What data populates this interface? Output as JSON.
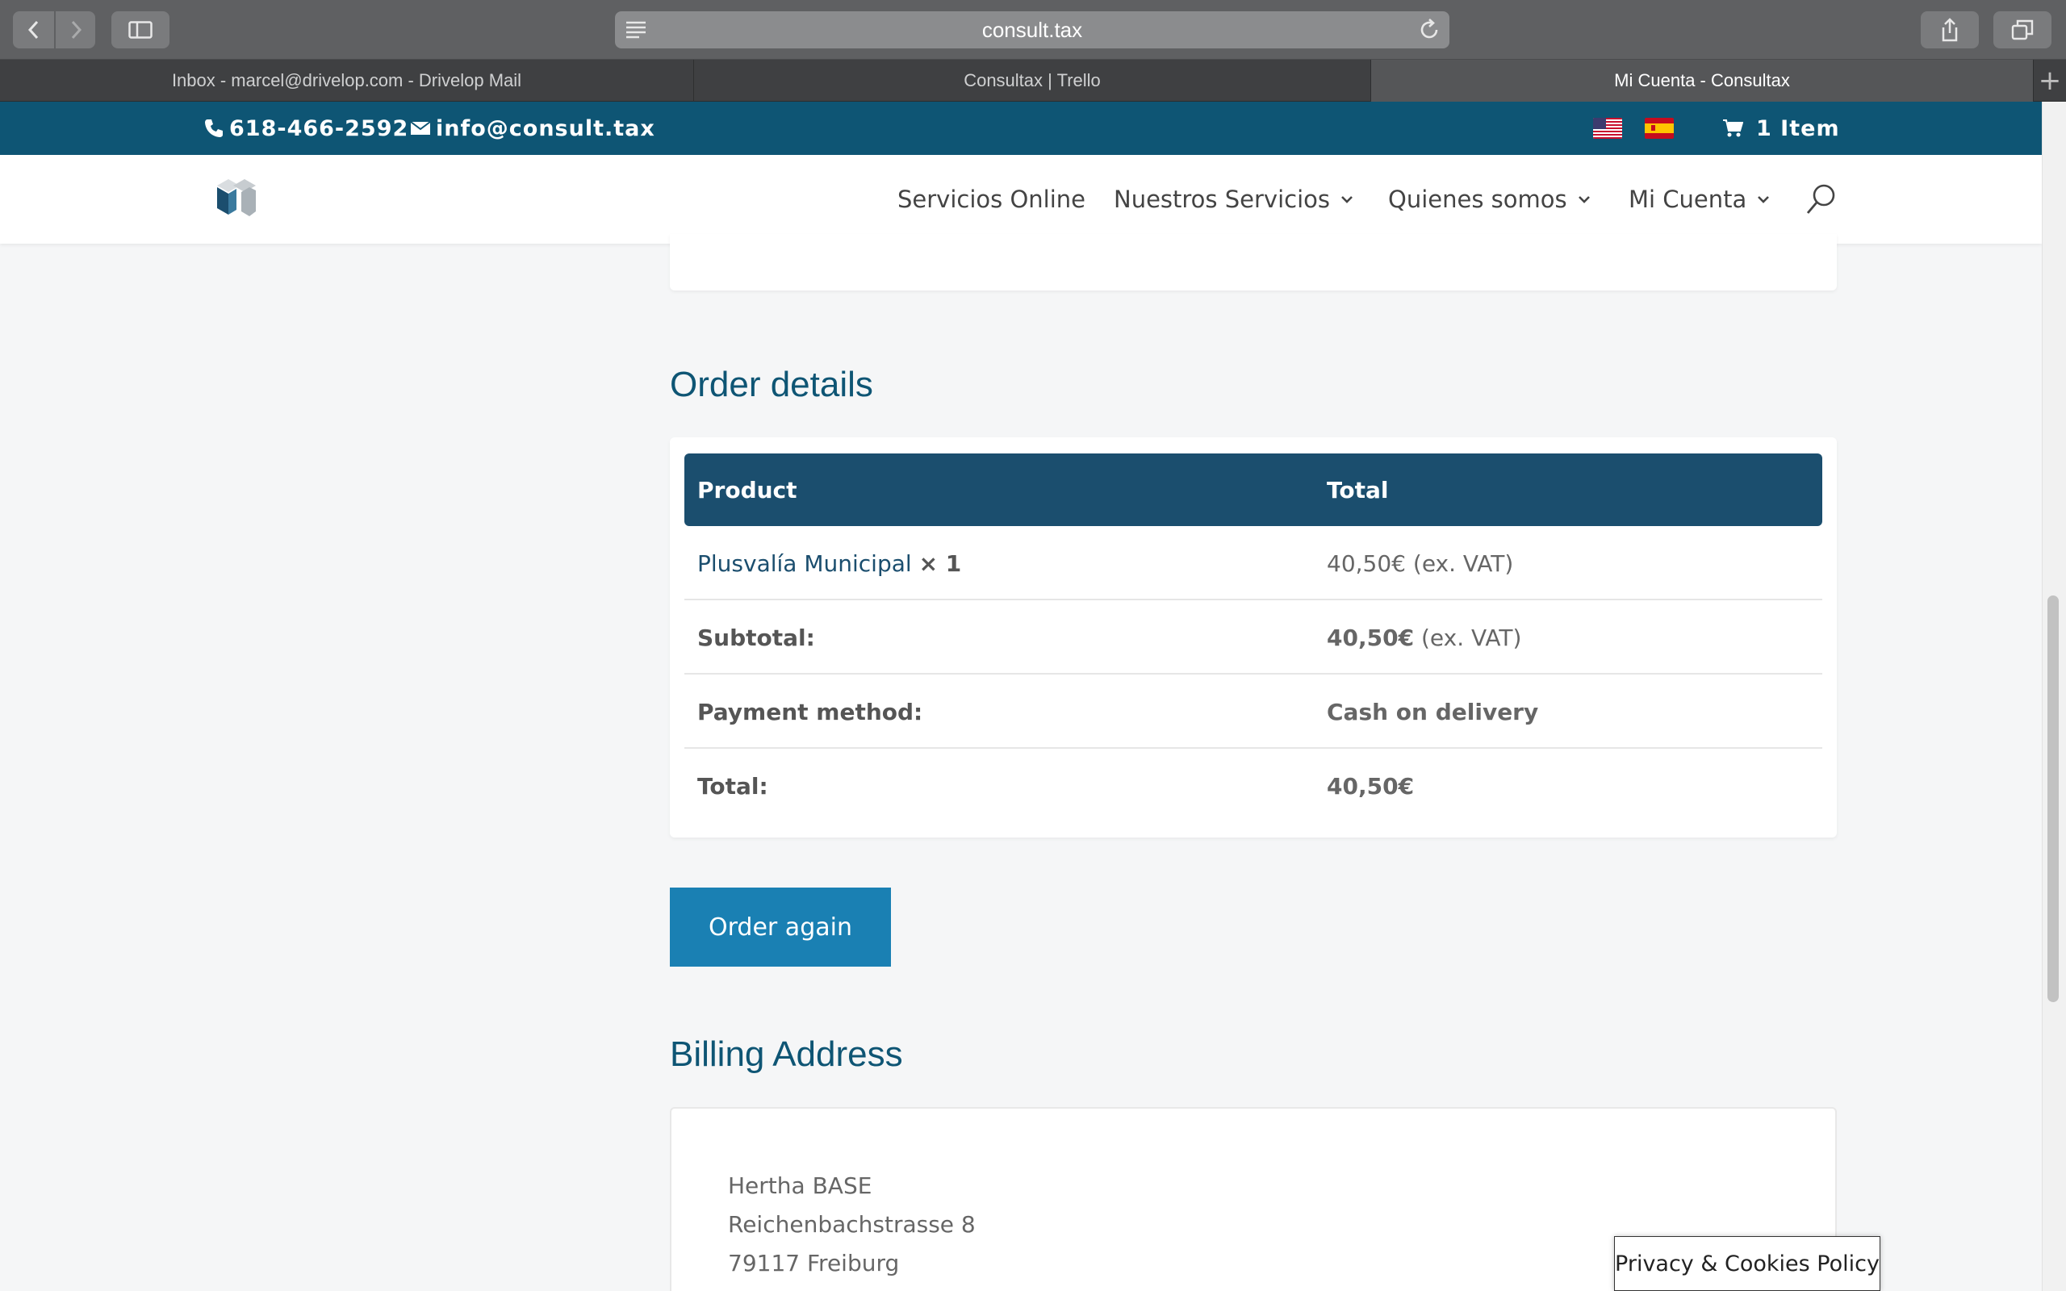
{
  "browser": {
    "url": "consult.tax",
    "tabs": [
      {
        "label": "Inbox - marcel@drivelop.com - Drivelop Mail",
        "active": false
      },
      {
        "label": "Consultax | Trello",
        "active": false
      },
      {
        "label": "Mi Cuenta - Consultax",
        "active": true
      }
    ]
  },
  "topbar": {
    "phone": "618-466-2592",
    "email": "info@consult.tax",
    "cart": "1 Item"
  },
  "nav": {
    "items": [
      "Servicios Online",
      "Nuestros Servicios",
      "Quienes somos",
      "Mi Cuenta"
    ]
  },
  "order": {
    "heading": "Order details",
    "col_product": "Product",
    "col_total": "Total",
    "item_name": "Plusvalía Municipal",
    "item_qty": "× 1",
    "item_price": "40,50€",
    "item_tax": "(ex. VAT)",
    "subtotal_label": "Subtotal:",
    "subtotal_value": "40,50€",
    "subtotal_tax": "(ex. VAT)",
    "payment_label": "Payment method:",
    "payment_value": "Cash on delivery",
    "total_label": "Total:",
    "total_value": "40,50€",
    "order_again": "Order again"
  },
  "billing": {
    "heading": "Billing Address",
    "lines": [
      "Hertha BASE",
      "Reichenbachstrasse 8",
      "79117 Freiburg"
    ]
  },
  "cookie": "Privacy & Cookies Policy",
  "colors": {
    "brand": "#0e5574",
    "table_header": "#1b4e6e",
    "button": "#1a80b3"
  }
}
